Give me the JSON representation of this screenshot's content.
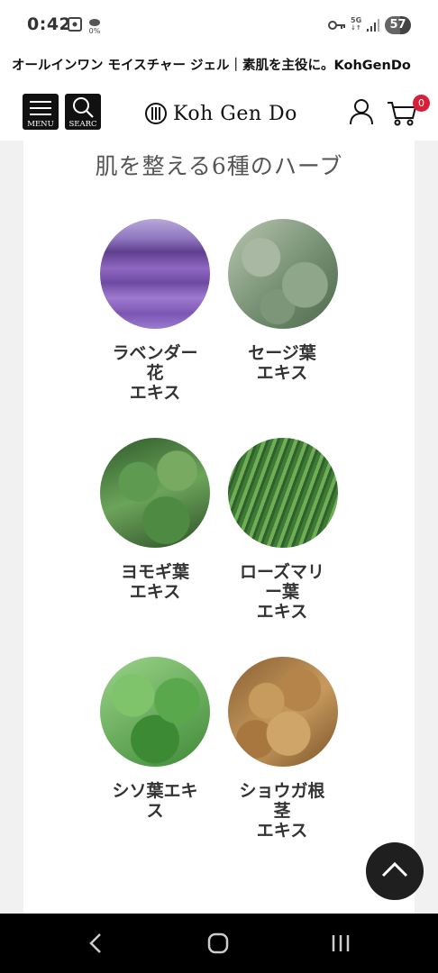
{
  "status_bar": {
    "time": "0:42",
    "net_top": "5G",
    "net_bottom": "0%",
    "battery_level": "57",
    "battery_fraction": 0.57
  },
  "browser": {
    "page_title": "オールインワン モイスチャー ジェル｜素肌を主役に。KohGenDo"
  },
  "header": {
    "menu_label": "MENU",
    "search_label": "SEARC",
    "logo_text": "Koh Gen Do",
    "cart_count": "0",
    "accent": "#d6203a"
  },
  "section": {
    "title": "肌を整える6種のハーブ",
    "herbs": [
      {
        "label": "ラベンダー\n花\nエキス",
        "image": "lavender-field-photo"
      },
      {
        "label": "セージ葉\nエキス",
        "image": "sage-leaves-photo"
      },
      {
        "label": "ヨモギ葉\nエキス",
        "image": "mugwort-leaves-photo"
      },
      {
        "label": "ローズマリ\nー葉\nエキス",
        "image": "rosemary-sprigs-photo"
      },
      {
        "label": "シソ葉エキ\nス",
        "image": "shiso-leaves-photo"
      },
      {
        "label": "ショウガ根\n茎\nエキス",
        "image": "ginger-root-photo"
      }
    ]
  },
  "icons": {
    "menu": "hamburger-icon",
    "search": "search-icon",
    "user": "user-icon",
    "cart": "cart-icon",
    "scroll_top": "chevron-up-icon",
    "nav_back": "back-icon",
    "nav_home": "home-icon",
    "nav_recents": "recents-icon"
  }
}
